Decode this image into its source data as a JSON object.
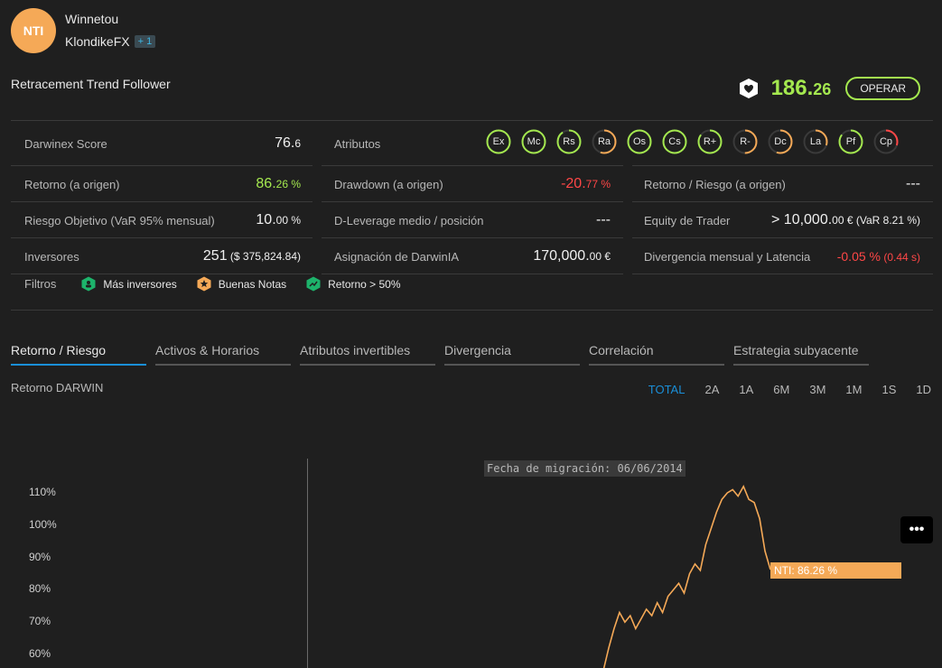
{
  "header": {
    "avatar_text": "NTI",
    "owner": "Winnetou",
    "provider": "KlondikeFX",
    "provider_badge": "+ 1",
    "strategy": "Retracement Trend Follower",
    "price_int": "186.",
    "price_dec": "26",
    "operate_label": "OPERAR"
  },
  "stats": {
    "score_label": "Darwinex Score",
    "score_int": "76.",
    "score_dec": "6",
    "attrs_label": "Atributos",
    "return_label": "Retorno (a origen)",
    "return_int": "86.",
    "return_dec": "26 %",
    "drawdown_label": "Drawdown (a origen)",
    "drawdown_int": "-20.",
    "drawdown_dec": "77 %",
    "rr_label": "Retorno / Riesgo (a origen)",
    "rr_value": "---",
    "risk_label": "Riesgo Objetivo (VaR 95% mensual)",
    "risk_int": "10.",
    "risk_dec": "00 %",
    "dlev_label": "D-Leverage medio / posición",
    "dlev_value": "---",
    "equity_label": "Equity de Trader",
    "equity_int": "> 10,000.",
    "equity_dec": "00 € (VaR 8.21 %)",
    "investors_label": "Inversores",
    "investors_int": "251",
    "investors_dec": " ($ 375,824.84)",
    "alloc_label": "Asignación de DarwinIA",
    "alloc_int": "170,000.",
    "alloc_dec": "00 €",
    "div_label": "Divergencia mensual y Latencia",
    "div_int": "-0.05 %",
    "div_dec": " (0.44 s)",
    "filters_label": "Filtros"
  },
  "attributes": [
    {
      "label": "Ex",
      "fill": 1.0,
      "color": "#a4e84f"
    },
    {
      "label": "Mc",
      "fill": 1.0,
      "color": "#a4e84f"
    },
    {
      "label": "Rs",
      "fill": 0.9,
      "color": "#a4e84f"
    },
    {
      "label": "Ra",
      "fill": 0.55,
      "color": "#f5a957"
    },
    {
      "label": "Os",
      "fill": 1.0,
      "color": "#a4e84f"
    },
    {
      "label": "Cs",
      "fill": 1.0,
      "color": "#a4e84f"
    },
    {
      "label": "R+",
      "fill": 0.85,
      "color": "#a4e84f"
    },
    {
      "label": "R-",
      "fill": 0.5,
      "color": "#f5a957"
    },
    {
      "label": "Dc",
      "fill": 0.55,
      "color": "#f5a957"
    },
    {
      "label": "La",
      "fill": 0.3,
      "color": "#f5a957"
    },
    {
      "label": "Pf",
      "fill": 0.85,
      "color": "#a4e84f"
    },
    {
      "label": "Cp",
      "fill": 0.3,
      "color": "#ff4747"
    }
  ],
  "filters": [
    {
      "label": "Más inversores",
      "icon": "investors-icon",
      "color": "#1db36b"
    },
    {
      "label": "Buenas Notas",
      "icon": "star-icon",
      "color": "#f5a957"
    },
    {
      "label": "Retorno > 50%",
      "icon": "return-icon",
      "color": "#1db36b"
    }
  ],
  "tabs": [
    "Retorno / Riesgo",
    "Activos & Horarios",
    "Atributos invertibles",
    "Divergencia",
    "Correlación",
    "Estrategia subyacente"
  ],
  "chart": {
    "title": "Retorno DARWIN",
    "ranges": [
      "TOTAL",
      "2A",
      "1A",
      "6M",
      "3M",
      "1M",
      "1S",
      "1D"
    ],
    "migration_label": "Fecha de migración: 06/06/2014",
    "last_label": "NTI: 86.26 %",
    "more": "•••"
  },
  "chart_data": {
    "type": "line",
    "title": "Retorno DARWIN",
    "yticks": [
      "60%",
      "70%",
      "80%",
      "90%",
      "100%",
      "110%"
    ],
    "ylim": [
      55,
      115
    ],
    "series": [
      {
        "name": "NTI",
        "color": "#f5a957",
        "values": [
          55,
          62,
          68,
          73,
          70,
          72,
          68,
          71,
          74,
          72,
          76,
          73,
          78,
          80,
          82,
          79,
          85,
          88,
          86,
          94,
          99,
          104,
          108,
          110,
          111,
          109,
          112,
          108,
          107,
          102,
          92,
          86.26
        ]
      }
    ]
  }
}
